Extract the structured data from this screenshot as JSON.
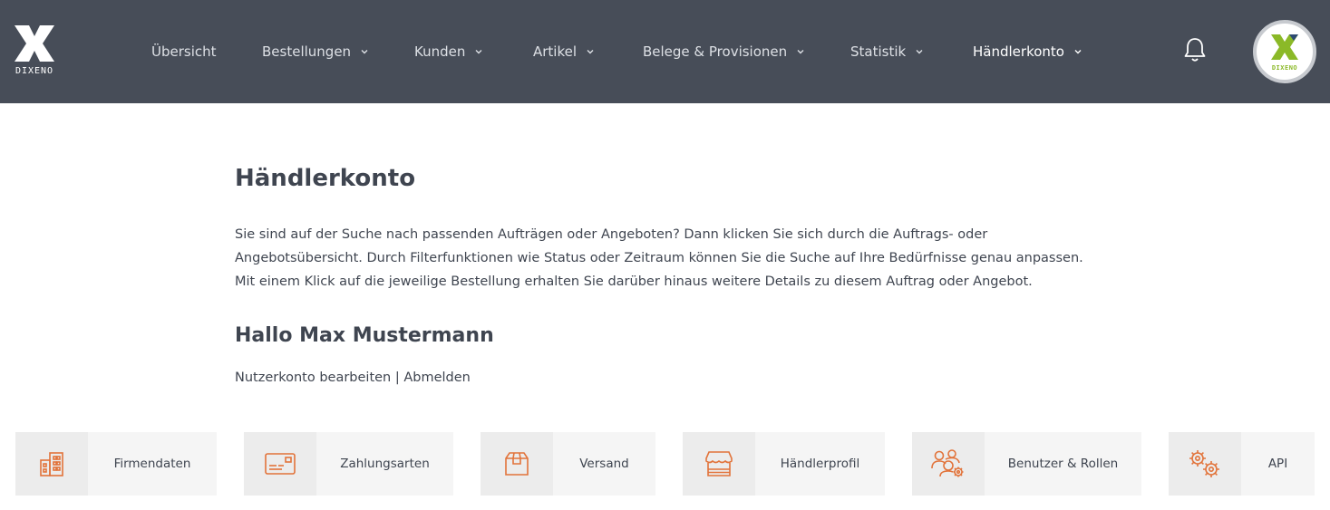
{
  "header": {
    "logo_text": "DIXENO",
    "nav": [
      {
        "label": "Übersicht",
        "has_dropdown": false
      },
      {
        "label": "Bestellungen",
        "has_dropdown": true
      },
      {
        "label": "Kunden",
        "has_dropdown": true
      },
      {
        "label": "Artikel",
        "has_dropdown": true
      },
      {
        "label": "Belege & Provisionen",
        "has_dropdown": true
      },
      {
        "label": "Statistik",
        "has_dropdown": true
      },
      {
        "label": "Händlerkonto",
        "has_dropdown": true,
        "active": true
      }
    ],
    "notification_icon": "bell-icon",
    "avatar_text": "DIXENO"
  },
  "main": {
    "title": "Händlerkonto",
    "intro_lines": [
      "Sie sind auf der Suche nach passenden Aufträgen oder Angeboten? Dann klicken Sie sich durch die Auftrags- oder",
      "Angebotsübersicht. Durch Filterfunktionen wie Status oder Zeitraum können Sie die Suche auf Ihre Bedürfnisse genau anpassen.",
      "Mit einem Klick auf die jeweilige Bestellung erhalten Sie darüber hinaus weitere Details zu diesem Auftrag oder Angebot."
    ],
    "greeting": "Hallo Max Mustermann",
    "edit_account_link": "Nutzerkonto bearbeiten",
    "separator": "|",
    "logout_link": "Abmelden"
  },
  "tiles": [
    {
      "label": "Firmendaten",
      "icon": "building-icon"
    },
    {
      "label": "Zahlungsarten",
      "icon": "credit-card-icon"
    },
    {
      "label": "Versand",
      "icon": "package-icon"
    },
    {
      "label": "Händlerprofil",
      "icon": "storefront-icon"
    },
    {
      "label": "Benutzer & Rollen",
      "icon": "users-settings-icon"
    },
    {
      "label": "API",
      "icon": "gears-icon"
    }
  ],
  "colors": {
    "header_bg": "#474d58",
    "accent_orange": "#e2733a",
    "logo_green": "#8bb927",
    "text": "#3f4550"
  }
}
